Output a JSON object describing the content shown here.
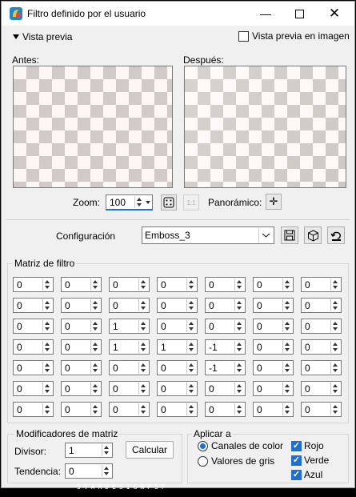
{
  "window": {
    "title": "Filtro definido por el usuario",
    "minimize_icon": "minimize-icon",
    "maximize_icon": "maximize-icon",
    "close_icon": "close-icon"
  },
  "preview": {
    "toggle_label": "Vista previa",
    "image_preview_label": "Vista previa en imagen",
    "image_preview_checked": false,
    "before_label": "Antes:",
    "after_label": "Después:"
  },
  "zoom": {
    "label": "Zoom:",
    "value": "100",
    "pan_label": "Panorámico:"
  },
  "config": {
    "label": "Configuración",
    "selected": "Emboss_3"
  },
  "matrix": {
    "title": "Matriz de filtro",
    "rows": [
      [
        "0",
        "0",
        "0",
        "0",
        "0",
        "0",
        "0"
      ],
      [
        "0",
        "0",
        "0",
        "0",
        "0",
        "0",
        "0"
      ],
      [
        "0",
        "0",
        "1",
        "0",
        "0",
        "0",
        "0"
      ],
      [
        "0",
        "0",
        "1",
        "1",
        "-1",
        "0",
        "0"
      ],
      [
        "0",
        "0",
        "0",
        "0",
        "-1",
        "0",
        "0"
      ],
      [
        "0",
        "0",
        "0",
        "0",
        "0",
        "0",
        "0"
      ],
      [
        "0",
        "0",
        "0",
        "0",
        "0",
        "0",
        "0"
      ]
    ]
  },
  "modifiers": {
    "title": "Modificadores de matriz",
    "divisor_label": "Divisor:",
    "divisor_value": "1",
    "bias_label": "Tendencia:",
    "bias_value": "0",
    "calc_label": "Calcular"
  },
  "apply": {
    "title": "Aplicar a",
    "color_channels": "Canales de color",
    "gray_values": "Valores de gris",
    "selected": "Canales de color",
    "red": "Rojo",
    "green": "Verde",
    "blue": "Azul",
    "red_checked": true,
    "green_checked": true,
    "blue_checked": true
  },
  "watermark": "STARDESIGNPSP"
}
